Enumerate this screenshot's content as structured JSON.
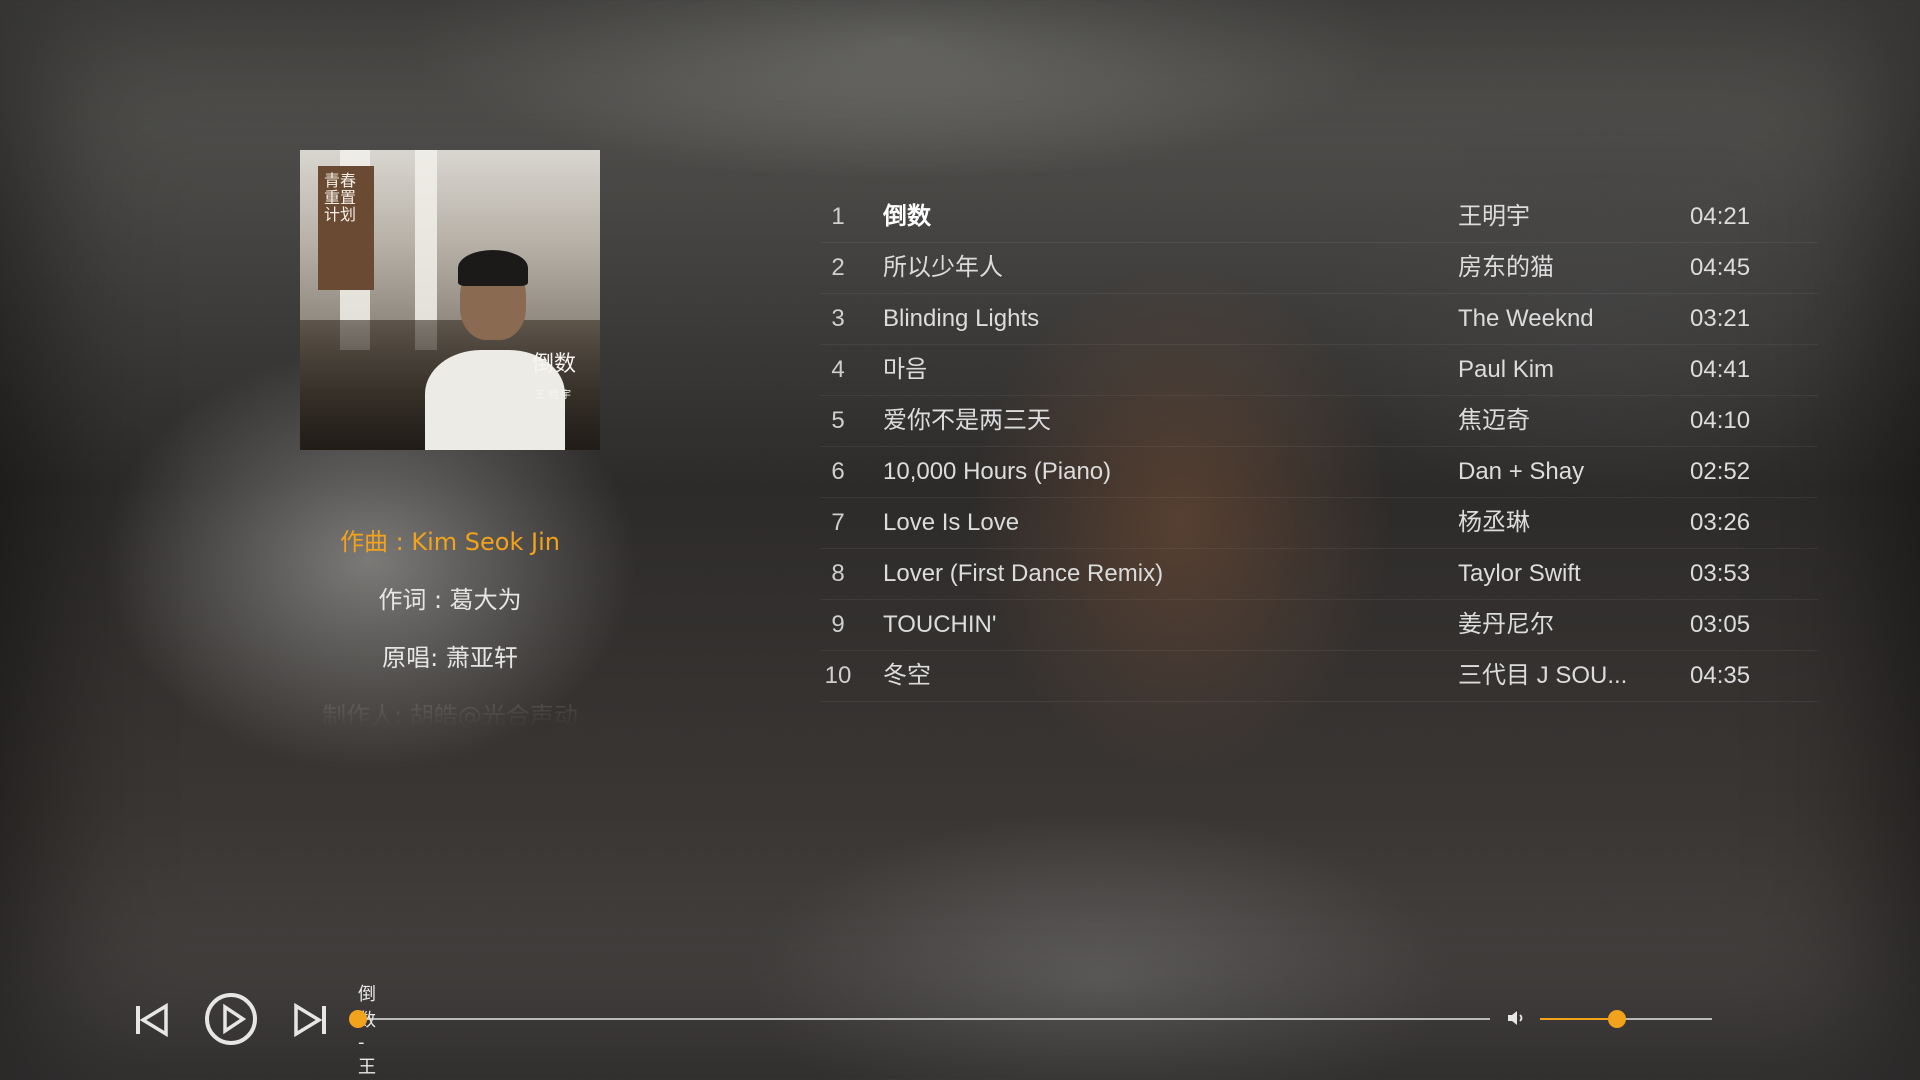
{
  "album": {
    "cover_banner_text": "青春重置计划",
    "cover_title": "倒数",
    "cover_artist": "王明宇"
  },
  "credits": [
    {
      "text": "作曲 : Kim Seok Jin",
      "state": "active"
    },
    {
      "text": "作词 : 葛大为",
      "state": "normal"
    },
    {
      "text": "原唱:  萧亚轩",
      "state": "normal"
    },
    {
      "text": "制作人:  胡皓@光合声动",
      "state": "fade"
    }
  ],
  "playlist": [
    {
      "num": "1",
      "title": "倒数",
      "artist": "王明宇",
      "duration": "04:21",
      "current": true
    },
    {
      "num": "2",
      "title": "所以少年人",
      "artist": "房东的猫",
      "duration": "04:45"
    },
    {
      "num": "3",
      "title": "Blinding Lights",
      "artist": "The Weeknd",
      "duration": "03:21"
    },
    {
      "num": "4",
      "title": "마음",
      "artist": "Paul Kim",
      "duration": "04:41"
    },
    {
      "num": "5",
      "title": "爱你不是两三天",
      "artist": "焦迈奇",
      "duration": "04:10"
    },
    {
      "num": "6",
      "title": "10,000 Hours (Piano)",
      "artist": "Dan + Shay",
      "duration": "02:52"
    },
    {
      "num": "7",
      "title": "Love Is Love",
      "artist": "杨丞琳",
      "duration": "03:26"
    },
    {
      "num": "8",
      "title": "Lover (First Dance Remix)",
      "artist": "Taylor Swift",
      "duration": "03:53"
    },
    {
      "num": "9",
      "title": "TOUCHIN'",
      "artist": "姜丹尼尔",
      "duration": "03:05"
    },
    {
      "num": "10",
      "title": "冬空",
      "artist": "三代目 J SOU...",
      "duration": "04:35"
    }
  ],
  "player": {
    "now_playing": "倒数 - 王明宇",
    "progress": 0.0,
    "volume": 0.45,
    "icons": {
      "prev": "skip-previous-icon",
      "play": "play-circle-icon",
      "next": "skip-next-icon",
      "volume": "volume-icon"
    },
    "accent_color": "#f3a21b"
  }
}
